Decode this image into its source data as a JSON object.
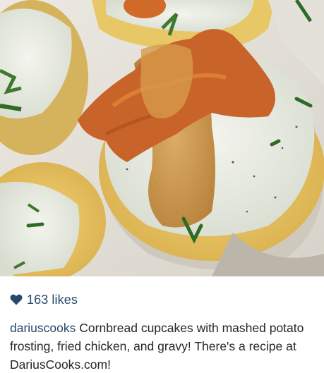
{
  "post": {
    "image_alt": "Cornbread cupcakes with mashed potato frosting, fried chicken and gravy",
    "likes": {
      "icon": "heart-icon",
      "label": "163 likes",
      "color": "#27496d"
    },
    "caption": {
      "username": "dariuscooks",
      "text": "Cornbread cupcakes with mashed potato frosting, fried chicken, and gravy! There's a recipe at DariusCooks.com!"
    }
  }
}
